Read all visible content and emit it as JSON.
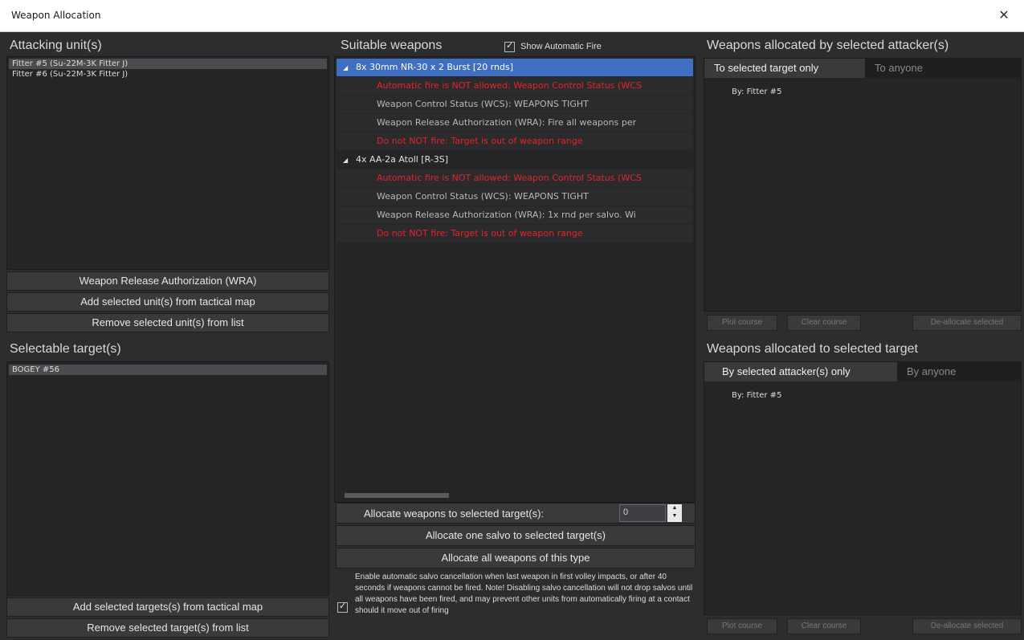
{
  "window": {
    "title": "Weapon Allocation",
    "close_glyph": "✕"
  },
  "attackers": {
    "header": "Attacking unit(s)",
    "items": [
      "Fitter #5 (Su-22M-3K Fitter J)",
      "Fitter #6 (Su-22M-3K Fitter J)"
    ],
    "buttons": {
      "wra": "Weapon Release Authorization (WRA)",
      "add": "Add selected unit(s) from tactical map",
      "remove": "Remove selected unit(s) from list"
    }
  },
  "targets": {
    "header": "Selectable target(s)",
    "items": [
      "BOGEY #56"
    ],
    "buttons": {
      "add": "Add selected targets(s) from tactical map",
      "remove": "Remove selected target(s) from list"
    }
  },
  "weapons": {
    "header": "Suitable weapons",
    "show_auto_fire": "Show Automatic Fire",
    "tree": [
      {
        "kind": "parent",
        "text": "8x 30mm NR-30 x 2 Burst [20 rnds]",
        "selected": true
      },
      {
        "kind": "child",
        "red": true,
        "text": "Automatic fire is NOT allowed: Weapon Control Status (WCS"
      },
      {
        "kind": "child",
        "red": false,
        "text": "Weapon Control Status (WCS): WEAPONS TIGHT"
      },
      {
        "kind": "child",
        "red": false,
        "text": "Weapon Release Authorization (WRA): Fire all weapons per"
      },
      {
        "kind": "child",
        "red": true,
        "text": "Do not NOT fire: Target is out of weapon range"
      },
      {
        "kind": "parent",
        "text": "4x AA-2a Atoll [R-3S]",
        "selected": false
      },
      {
        "kind": "child",
        "red": true,
        "text": "Automatic fire is NOT allowed: Weapon Control Status (WCS"
      },
      {
        "kind": "child",
        "red": false,
        "text": "Weapon Control Status (WCS): WEAPONS TIGHT"
      },
      {
        "kind": "child",
        "red": false,
        "text": "Weapon Release Authorization (WRA): 1x rnd per salvo. Wi"
      },
      {
        "kind": "child",
        "red": true,
        "text": "Do not NOT fire: Target is out of weapon range"
      }
    ],
    "allocate_to_selected": "Allocate weapons to selected target(s):",
    "allocate_value": "0",
    "allocate_one_salvo": "Allocate one salvo to selected target(s)",
    "allocate_all": "Allocate all weapons of this type",
    "salvo_cancel_text": "Enable automatic salvo cancellation when last weapon in first volley impacts, or after 40 seconds if weapons cannot be fired. Note! Disabling salvo cancellation will not drop salvos until all weapons have been fired, and may prevent other units from automatically firing at a contact should it move out of firing"
  },
  "by_attacker": {
    "header": "Weapons allocated by selected attacker(s)",
    "tabs": [
      "To selected target only",
      "To anyone"
    ],
    "entries": [
      "By: Fitter #5"
    ],
    "buttons": {
      "plot": "Plot course",
      "clear": "Clear course",
      "deallocate": "De-allocate selected"
    }
  },
  "to_target": {
    "header": "Weapons allocated to selected target",
    "tabs": [
      "By selected attacker(s) only",
      "By anyone"
    ],
    "entries": [
      "By: Fitter #5"
    ],
    "buttons": {
      "plot": "Plot course",
      "clear": "Clear course",
      "deallocate": "De-allocate selected"
    }
  },
  "colors": {
    "selection_blue": "#3e6fc2",
    "warning_red": "#e2242b",
    "background": "#2d2d30"
  }
}
